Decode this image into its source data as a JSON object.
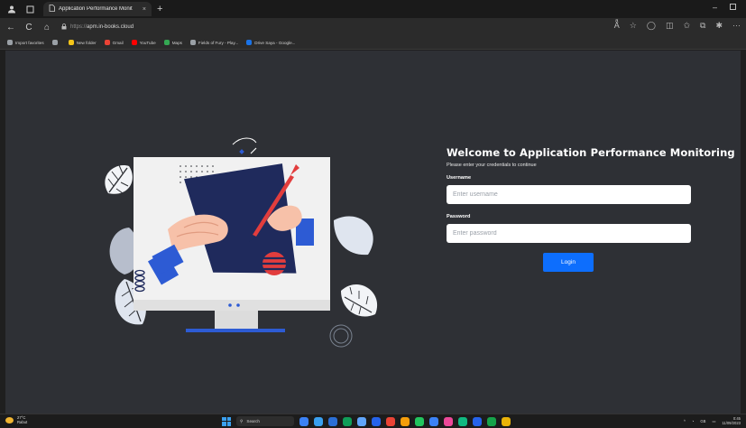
{
  "browser": {
    "tab_title": "Application Performance Monit",
    "tab_close": "×",
    "new_tab": "+",
    "url_prefix": "https://",
    "url": "apm.in-books.cloud",
    "favorites": [
      {
        "label": "Import favorites",
        "color": "#9aa0a6"
      },
      {
        "label": "",
        "color": "#9aa0a6"
      },
      {
        "label": "New folder",
        "color": "#f5c518"
      },
      {
        "label": "Gmail",
        "color": "#ea4335"
      },
      {
        "label": "YouTube",
        "color": "#ff0000"
      },
      {
        "label": "Maps",
        "color": "#34a853"
      },
      {
        "label": "Fields of Fury - Play...",
        "color": "#9aa0a6"
      },
      {
        "label": "Drive Saya - Google...",
        "color": "#1a73e8"
      }
    ]
  },
  "login": {
    "title": "Welcome to Application Performance Monitoring",
    "subtitle": "Please enter your credentials to continue",
    "username_label": "Username",
    "username_placeholder": "Enter username",
    "password_label": "Password",
    "password_placeholder": "Enter password",
    "button": "Login"
  },
  "taskbar": {
    "weather_temp": "27°C",
    "weather_desc": "Rabut",
    "search": "Search",
    "lang": "GB",
    "time": "0:45",
    "date": "11/09/2023",
    "apps": [
      "#3b82f6",
      "#3aa0f0",
      "#2b6fd6",
      "#0f9d58",
      "#60a5fa",
      "#2563eb",
      "#ea4335",
      "#f59e0b",
      "#22c55e",
      "#3b82f6",
      "#ec4899",
      "#10b981",
      "#2563eb",
      "#16a34a",
      "#eab308"
    ]
  },
  "colors": {
    "page_bg": "#2e3035",
    "accent": "#0d6efd",
    "illus_navy": "#1f2a5c",
    "illus_red": "#e23d3d",
    "illus_blue": "#2d5bd4"
  }
}
